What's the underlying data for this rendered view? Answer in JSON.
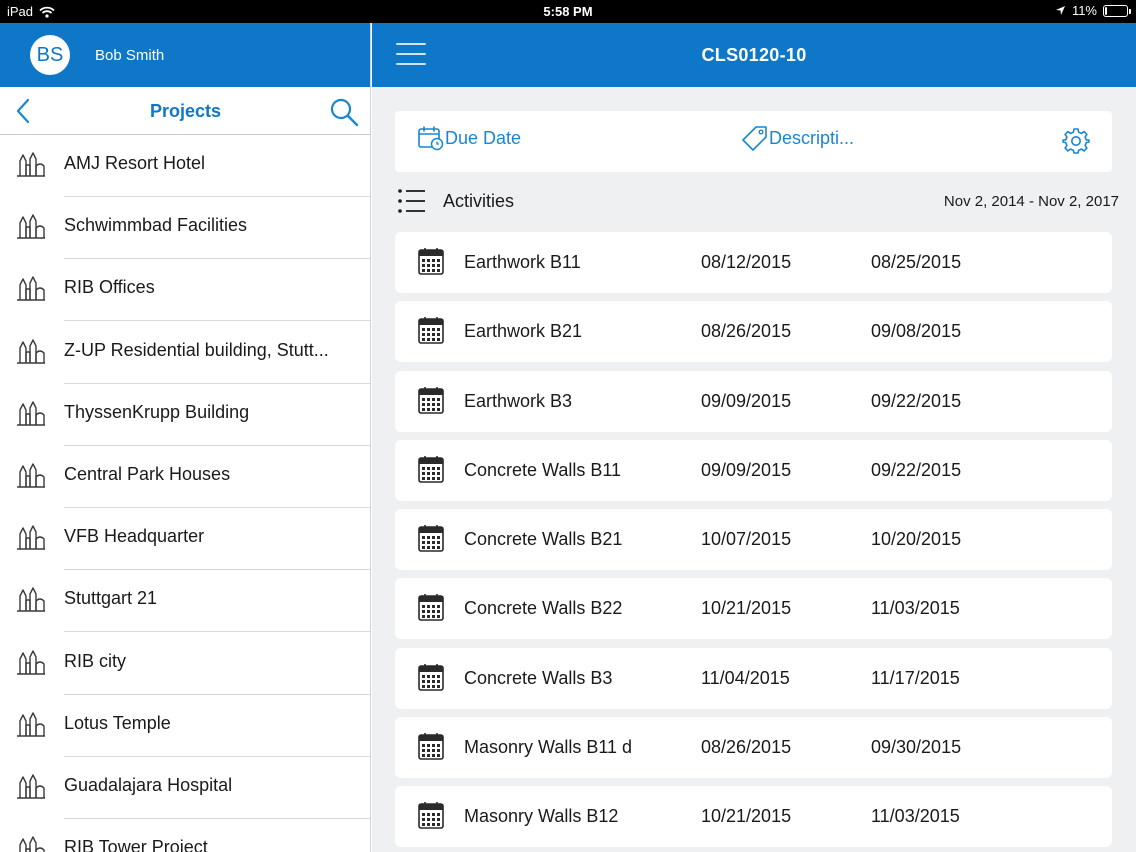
{
  "status_bar": {
    "device": "iPad",
    "time": "5:58 PM",
    "battery": "11%",
    "battery_level": 0.11
  },
  "sidebar": {
    "avatar_initials": "BS",
    "user_name": "Bob Smith",
    "title": "Projects",
    "projects": [
      "AMJ Resort Hotel",
      "Schwimmbad Facilities",
      "RIB Offices",
      "Z-UP Residential building, Stutt...",
      "ThyssenKrupp Building",
      "Central Park Houses",
      "VFB Headquarter",
      "Stuttgart 21",
      "RIB city",
      "Lotus Temple",
      "Guadalajara Hospital",
      "RIB Tower Project"
    ]
  },
  "main": {
    "title": "CLS0120-10",
    "filters": {
      "due_date": "Due Date",
      "description": "Descripti..."
    },
    "activities_label": "Activities",
    "date_range": "Nov 2, 2014 - Nov 2, 2017",
    "activities": [
      {
        "name": "Earthwork B11",
        "start": "08/12/2015",
        "end": "08/25/2015"
      },
      {
        "name": "Earthwork B21",
        "start": "08/26/2015",
        "end": "09/08/2015"
      },
      {
        "name": "Earthwork B3",
        "start": "09/09/2015",
        "end": "09/22/2015"
      },
      {
        "name": "Concrete Walls B11",
        "start": "09/09/2015",
        "end": "09/22/2015"
      },
      {
        "name": "Concrete Walls B21",
        "start": "10/07/2015",
        "end": "10/20/2015"
      },
      {
        "name": "Concrete Walls B22",
        "start": "10/21/2015",
        "end": "11/03/2015"
      },
      {
        "name": "Concrete Walls B3",
        "start": "11/04/2015",
        "end": "11/17/2015"
      },
      {
        "name": "Masonry Walls B11 d",
        "start": "08/26/2015",
        "end": "09/30/2015"
      },
      {
        "name": "Masonry Walls B12",
        "start": "10/21/2015",
        "end": "11/03/2015"
      }
    ]
  },
  "colors": {
    "primary": "#0e77c8",
    "link": "#1a86d0",
    "background": "#eff0f2"
  },
  "icons": [
    "wifi-icon",
    "location-arrow-icon",
    "battery-icon",
    "back-chevron-icon",
    "search-icon",
    "building-icon",
    "hamburger-menu-icon",
    "calendar-clock-icon",
    "tag-icon",
    "gear-icon",
    "list-icon",
    "calendar-icon"
  ]
}
